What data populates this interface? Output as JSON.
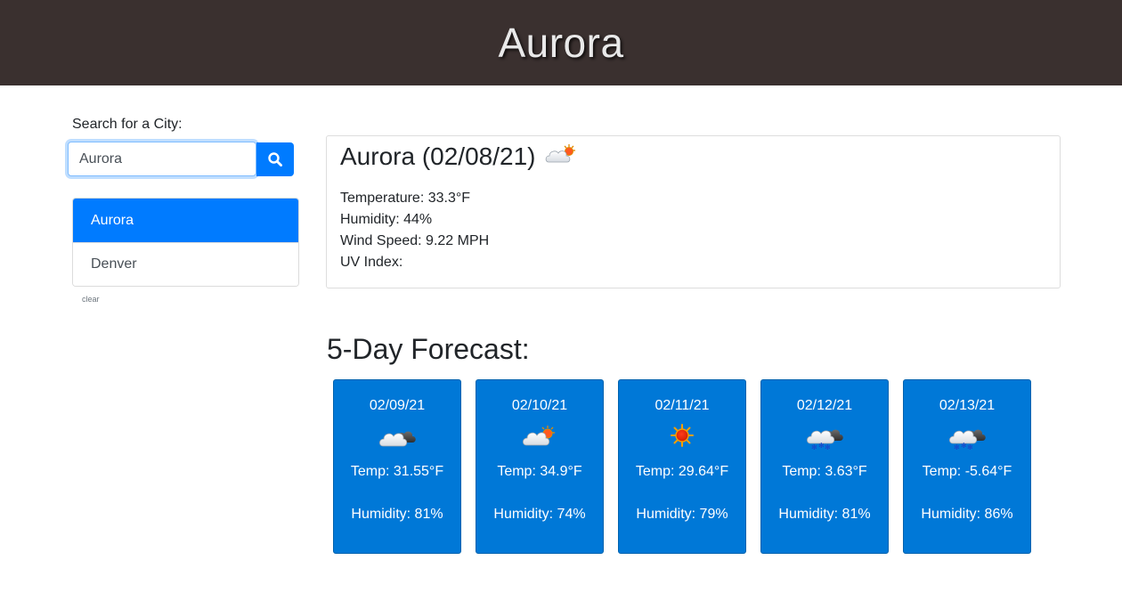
{
  "header": {
    "title": "Aurora"
  },
  "search": {
    "label": "Search for a City:",
    "value": "Aurora",
    "button_icon": "search-icon"
  },
  "history": {
    "items": [
      {
        "label": "Aurora",
        "active": true
      },
      {
        "label": "Denver",
        "active": false
      }
    ],
    "clear_label": "clear"
  },
  "current": {
    "title": "Aurora (02/08/21)",
    "icon": "partly-cloudy-icon",
    "temperature": "Temperature: 33.3°F",
    "humidity": "Humidity: 44%",
    "wind": "Wind Speed: 9.22 MPH",
    "uv": "UV Index:"
  },
  "forecast": {
    "heading": "5-Day Forecast:",
    "days": [
      {
        "date": "02/09/21",
        "icon": "cloudy-icon",
        "temp": "Temp: 31.55°F",
        "humidity": "Humidity: 81%"
      },
      {
        "date": "02/10/21",
        "icon": "partly-cloudy-icon",
        "temp": "Temp: 34.9°F",
        "humidity": "Humidity: 74%"
      },
      {
        "date": "02/11/21",
        "icon": "sun-icon",
        "temp": "Temp: 29.64°F",
        "humidity": "Humidity: 79%"
      },
      {
        "date": "02/12/21",
        "icon": "snow-icon",
        "temp": "Temp: 3.63°F",
        "humidity": "Humidity: 81%"
      },
      {
        "date": "02/13/21",
        "icon": "snow-icon",
        "temp": "Temp: -5.64°F",
        "humidity": "Humidity: 86%"
      }
    ]
  },
  "colors": {
    "header_bg": "#3a302f",
    "accent": "#007bff",
    "card_bg": "#0078d7"
  }
}
